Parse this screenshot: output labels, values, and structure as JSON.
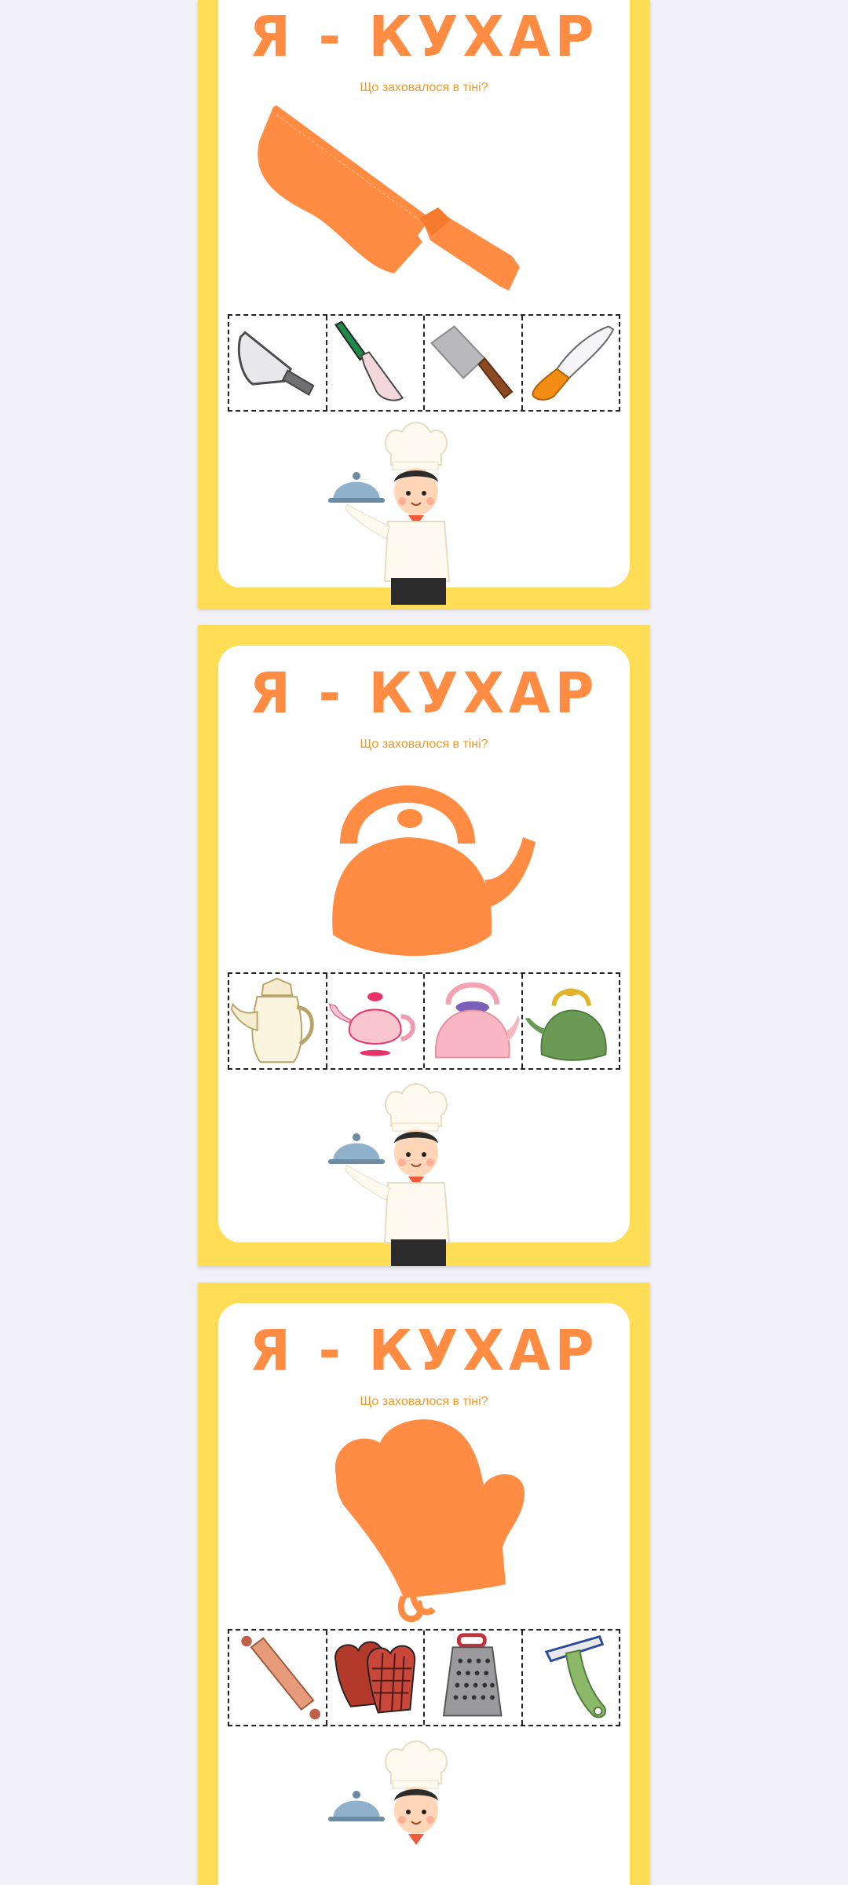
{
  "cards": [
    {
      "title": "Я - КУХАР",
      "subtitle": "Що заховалося в тіні?",
      "shadow": "knife-cleaver",
      "options": [
        "cleaver-knife",
        "chef-knife-green",
        "meat-cleaver",
        "orange-knife"
      ]
    },
    {
      "title": "Я - КУХАР",
      "subtitle": "Що заховалося в тіні?",
      "shadow": "kettle",
      "options": [
        "ornate-teapot",
        "pink-teapot",
        "pink-kettle",
        "green-kettle"
      ]
    },
    {
      "title": "Я - КУХАР",
      "subtitle": "Що заховалося в тіні?",
      "shadow": "oven-mitt",
      "options": [
        "rolling-pin",
        "oven-mitts",
        "grater",
        "peeler"
      ]
    }
  ],
  "colors": {
    "page_bg": "#f0f0f6",
    "card_frame": "#ffdd55",
    "accent": "#ff8c42",
    "subtitle": "#ef9a2a"
  }
}
